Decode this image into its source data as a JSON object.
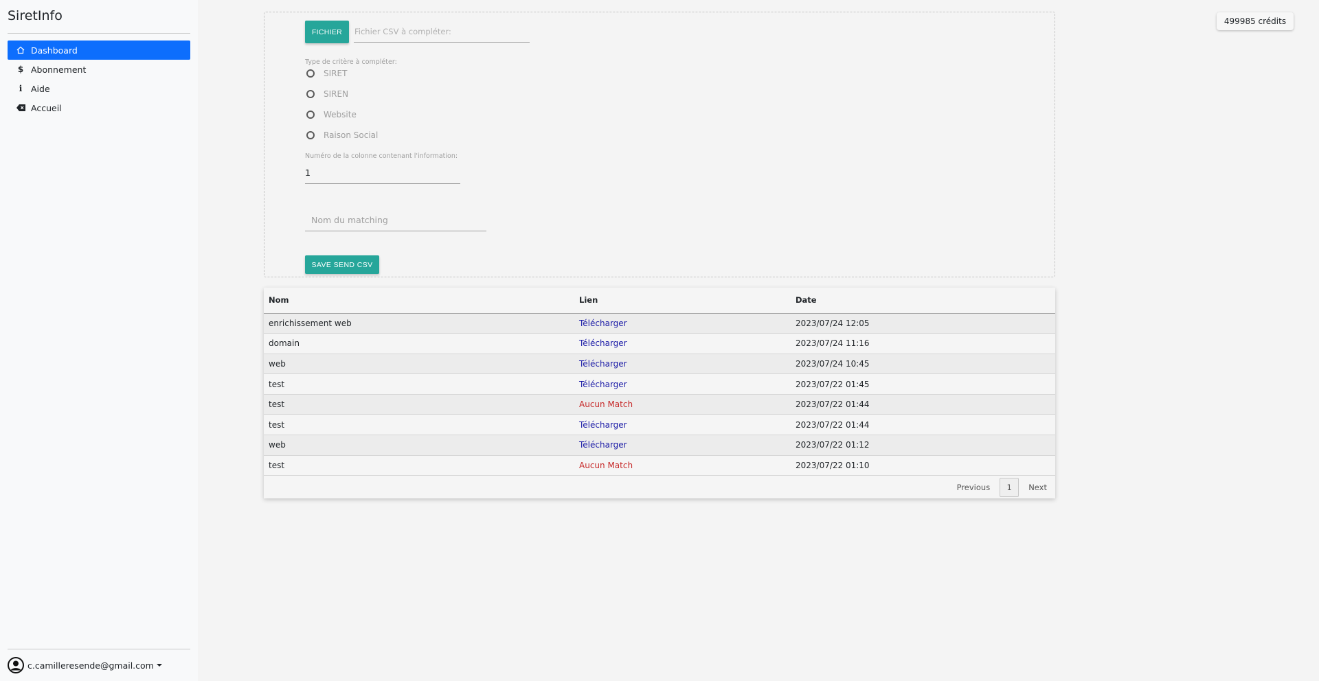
{
  "app": {
    "title": "SiretInfo"
  },
  "sidebar": {
    "items": [
      {
        "label": "Dashboard",
        "icon": "home-icon",
        "active": true
      },
      {
        "label": "Abonnement",
        "icon": "dollar-icon"
      },
      {
        "label": "Aide",
        "icon": "info-icon"
      },
      {
        "label": "Accueil",
        "icon": "backspace-icon"
      }
    ],
    "user": {
      "email": "c.camilleresende@gmail.com",
      "icon": "user-circle-icon"
    }
  },
  "credits": {
    "label": "499985 crédits"
  },
  "upload": {
    "file_button": "FICHIER",
    "file_placeholder": "Fichier CSV à compléter:",
    "criteria_label": "Type de critère à compléter:",
    "criteria_options": [
      "SIRET",
      "SIREN",
      "Website",
      "Raison Social"
    ],
    "column_label": "Numéro de la colonne contenant l'information:",
    "column_value": "1",
    "matching_placeholder": "Nom du matching",
    "save_button": "SAVE SEND CSV"
  },
  "table": {
    "headers": [
      "Nom",
      "Lien",
      "Date"
    ],
    "rows": [
      {
        "nom": "enrichissement web",
        "lien": "Télécharger",
        "status": "download",
        "date": "2023/07/24 12:05"
      },
      {
        "nom": "domain",
        "lien": "Télécharger",
        "status": "download",
        "date": "2023/07/24 11:16"
      },
      {
        "nom": "web",
        "lien": "Télécharger",
        "status": "download",
        "date": "2023/07/24 10:45"
      },
      {
        "nom": "test",
        "lien": "Télécharger",
        "status": "download",
        "date": "2023/07/22 01:45"
      },
      {
        "nom": "test",
        "lien": "Aucun Match",
        "status": "none",
        "date": "2023/07/22 01:44"
      },
      {
        "nom": "test",
        "lien": "Télécharger",
        "status": "download",
        "date": "2023/07/22 01:44"
      },
      {
        "nom": "web",
        "lien": "Télécharger",
        "status": "download",
        "date": "2023/07/22 01:12"
      },
      {
        "nom": "test",
        "lien": "Aucun Match",
        "status": "none",
        "date": "2023/07/22 01:10"
      }
    ],
    "pagination": {
      "previous": "Previous",
      "page": "1",
      "next": "Next"
    }
  },
  "colors": {
    "accent": "#26a69a",
    "active_nav": "#0d6efd",
    "download_link": "#1a1aa6",
    "no_match": "#c62828"
  }
}
